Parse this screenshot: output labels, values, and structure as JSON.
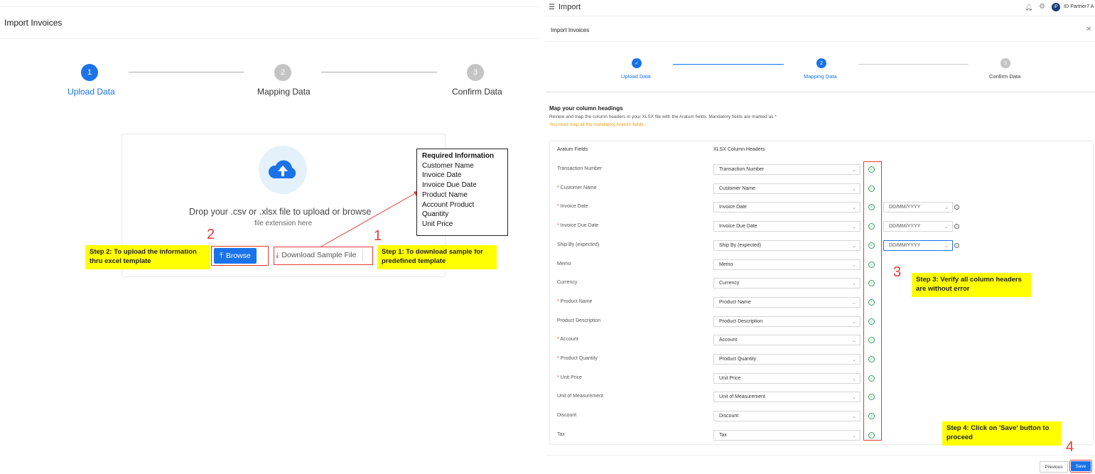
{
  "left": {
    "title": "Import Invoices",
    "steps": [
      {
        "number": "1",
        "label": "Upload Data"
      },
      {
        "number": "2",
        "label": "Mapping Data"
      },
      {
        "number": "3",
        "label": "Confirm Data"
      }
    ],
    "drop_text": "Drop your .csv or .xlsx file to upload or browse",
    "ext_text": "file extension here",
    "browse_label": "Browse",
    "download_label": "Download Sample File",
    "marker_1": "1",
    "marker_2": "2",
    "note_step1": "Step 1: To download sample for predefined template",
    "note_step2": "Step 2: To upload the information thru excel template",
    "required_info": {
      "title": "Required Information",
      "items": [
        "Customer Name",
        "Invoice Date",
        "Invoice Due Date",
        "Product Name",
        "Account Product",
        "Quantity",
        "Unit Price"
      ]
    }
  },
  "right": {
    "app_title": "Import",
    "user": "ID-Partner7 A",
    "modal_title": "Import Invoices",
    "steps": [
      {
        "number": "",
        "label": "Upload Data"
      },
      {
        "number": "2",
        "label": "Mapping Data"
      },
      {
        "number": "3",
        "label": "Confirm Data"
      }
    ],
    "map_title": "Map your column headings",
    "map_desc": "Review and map the column headers in your XLSX file with the Aratum fields. Mandatory fields are marked as *",
    "map_warn": "You must map all the mandatory Aratum fields.",
    "col_fields": "Aratum Fields",
    "col_headers": "XLSX Column Headers",
    "rows": [
      {
        "field": "Transaction Number",
        "required": false,
        "value": "Transaction Number",
        "date": ""
      },
      {
        "field": "Customer Name",
        "required": true,
        "value": "Customer Name",
        "date": ""
      },
      {
        "field": "Invoice Date",
        "required": true,
        "value": "Invoice Date",
        "date": "DD/MM/YYYY"
      },
      {
        "field": "Invoice Due Date",
        "required": true,
        "value": "Invoice Due Date",
        "date": "DD/MM/YYYY"
      },
      {
        "field": "Ship By (expected)",
        "required": false,
        "value": "Ship By (expected)",
        "date": "DD/MM/YYYY"
      },
      {
        "field": "Memo",
        "required": false,
        "value": "Memo",
        "date": ""
      },
      {
        "field": "Currency",
        "required": false,
        "value": "Currency",
        "date": ""
      },
      {
        "field": "Product Name",
        "required": true,
        "value": "Product Name",
        "date": ""
      },
      {
        "field": "Product Description",
        "required": false,
        "value": "Product Description",
        "date": ""
      },
      {
        "field": "Account",
        "required": true,
        "value": "Account",
        "date": ""
      },
      {
        "field": "Product Quantity",
        "required": true,
        "value": "Product Quantity",
        "date": ""
      },
      {
        "field": "Unit Price",
        "required": true,
        "value": "Unit Price",
        "date": ""
      },
      {
        "field": "Unit of Measurement",
        "required": false,
        "value": "Unit of Measurement",
        "date": ""
      },
      {
        "field": "Discount",
        "required": false,
        "value": "Discount",
        "date": ""
      },
      {
        "field": "Tax",
        "required": false,
        "value": "Tax",
        "date": ""
      }
    ],
    "marker_3": "3",
    "marker_4": "4",
    "note_step3": "Step 3: Verify all column headers are without error",
    "note_step4": "Step 4: Click on 'Save' button to proceed",
    "previous_label": "Previous",
    "save_label": "Save"
  },
  "colors": {
    "primary": "#1a73e8",
    "annotation": "#e53935",
    "sticky": "#ffff00",
    "success": "#2e9e5b",
    "warning": "#f39c12"
  }
}
